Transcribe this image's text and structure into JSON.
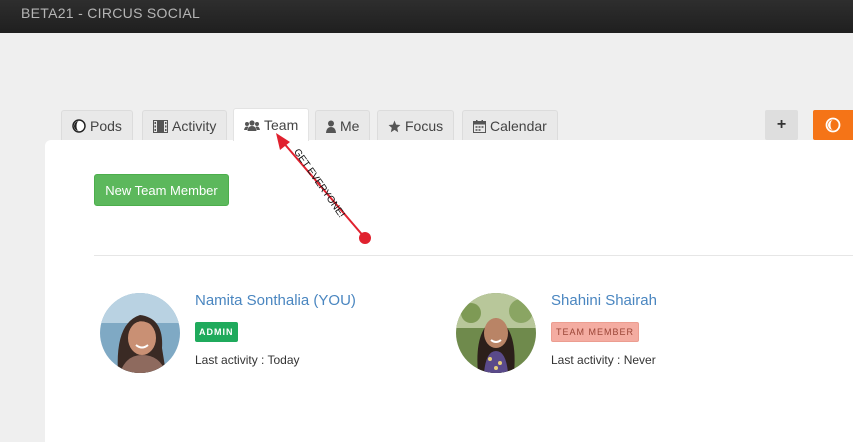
{
  "window": {
    "title": "BETA21 - CIRCUS SOCIAL"
  },
  "tabs": [
    {
      "label": "Pods",
      "icon": "pods-icon"
    },
    {
      "label": "Activity",
      "icon": "film-icon"
    },
    {
      "label": "Team",
      "icon": "users-icon",
      "active": true
    },
    {
      "label": "Me",
      "icon": "user-icon"
    },
    {
      "label": "Focus",
      "icon": "star-icon"
    },
    {
      "label": "Calendar",
      "icon": "calendar-icon"
    }
  ],
  "toolbar": {
    "add_label": "+"
  },
  "main": {
    "new_member_label": "New Team Member",
    "annotation": "GET EVERYONE!",
    "members": [
      {
        "name": "Namita Sonthalia (YOU)",
        "role": "ADMIN",
        "activity": "Last activity : Today"
      },
      {
        "name": "Shahini Shairah",
        "role": "TEAM MEMBER",
        "activity": "Last activity : Never"
      }
    ]
  },
  "colors": {
    "accent_green": "#5cb85c",
    "admin_badge": "#1faa5c",
    "member_badge": "#f4aca1",
    "orange": "#f57417",
    "link_blue": "#4a86c0",
    "annotation_red": "#e0212e"
  }
}
